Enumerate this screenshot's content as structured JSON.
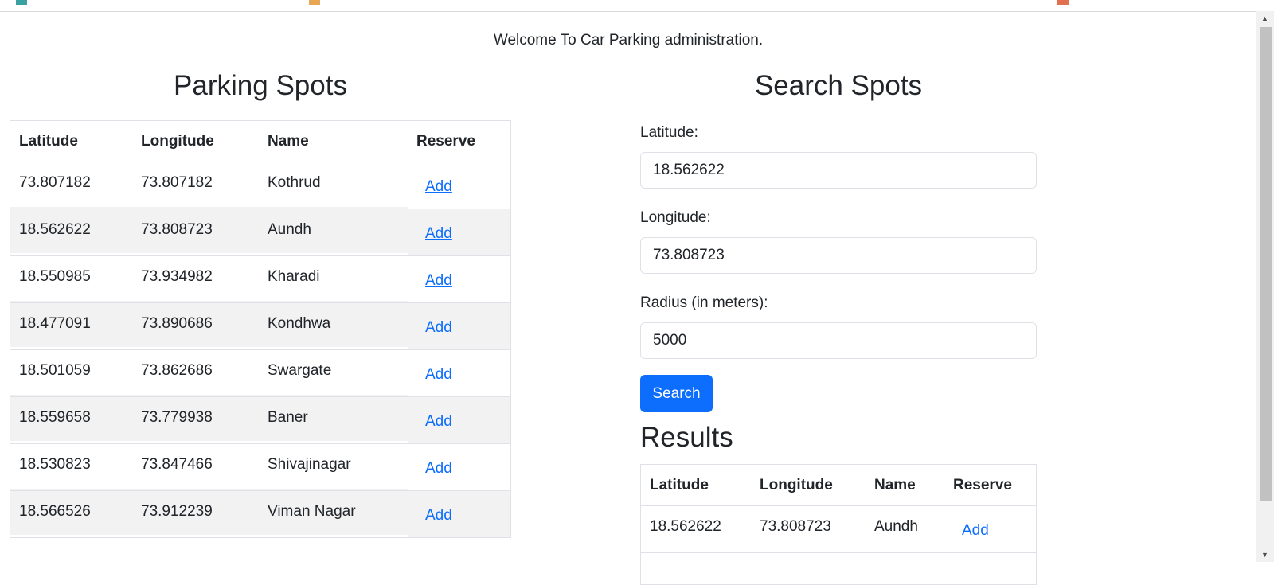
{
  "header": {
    "welcome": "Welcome To Car Parking administration."
  },
  "parking_spots": {
    "title": "Parking Spots",
    "columns": [
      "Latitude",
      "Longitude",
      "Name",
      "Reserve"
    ],
    "rows": [
      {
        "lat": "73.807182",
        "lng": "73.807182",
        "name": "Kothrud",
        "action": "Add"
      },
      {
        "lat": "18.562622",
        "lng": "73.808723",
        "name": "Aundh",
        "action": "Add"
      },
      {
        "lat": "18.550985",
        "lng": "73.934982",
        "name": "Kharadi",
        "action": "Add"
      },
      {
        "lat": "18.477091",
        "lng": "73.890686",
        "name": "Kondhwa",
        "action": "Add"
      },
      {
        "lat": "18.501059",
        "lng": "73.862686",
        "name": "Swargate",
        "action": "Add"
      },
      {
        "lat": "18.559658",
        "lng": "73.779938",
        "name": "Baner",
        "action": "Add"
      },
      {
        "lat": "18.530823",
        "lng": "73.847466",
        "name": "Shivajinagar",
        "action": "Add"
      },
      {
        "lat": "18.566526",
        "lng": "73.912239",
        "name": "Viman Nagar",
        "action": "Add"
      }
    ]
  },
  "search": {
    "title": "Search Spots",
    "latitude_label": "Latitude:",
    "latitude_value": "18.562622",
    "longitude_label": "Longitude:",
    "longitude_value": "73.808723",
    "radius_label": "Radius (in meters):",
    "radius_value": "5000",
    "button_label": "Search"
  },
  "results": {
    "title": "Results",
    "columns": [
      "Latitude",
      "Longitude",
      "Name",
      "Reserve"
    ],
    "rows": [
      {
        "lat": "18.562622",
        "lng": "73.808723",
        "name": "Aundh",
        "action": "Add"
      }
    ]
  },
  "colors": {
    "accent": "#0d6efd",
    "stripe": "#f2f2f2",
    "border": "#dee2e6"
  }
}
